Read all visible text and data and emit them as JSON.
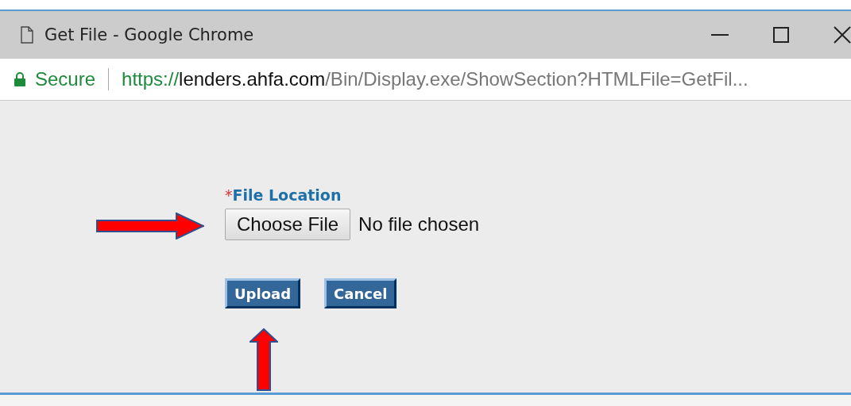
{
  "window": {
    "title": "Get File - Google Chrome"
  },
  "address_bar": {
    "security": "Secure",
    "url_scheme": "https://",
    "url_host": "lenders.ahfa.com",
    "url_path": "/Bin/Display.exe/ShowSection?HTMLFile=GetFil..."
  },
  "form": {
    "required_mark": "*",
    "label": "File Location",
    "file_button": "Choose File",
    "file_status": "No file chosen",
    "buttons": [
      "Upload",
      "Cancel"
    ]
  }
}
